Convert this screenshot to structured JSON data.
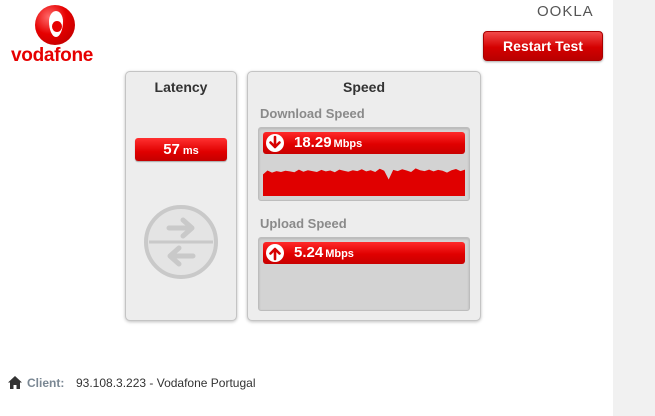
{
  "brand": {
    "name": "vodafone",
    "partner": "OOKLA"
  },
  "actions": {
    "restart_label": "Restart Test"
  },
  "latency": {
    "title": "Latency",
    "value": "57",
    "unit": "ms"
  },
  "speed": {
    "title": "Speed",
    "download": {
      "label": "Download Speed",
      "value": "18.29",
      "unit": "Mbps",
      "graph_samples": [
        0.72,
        0.85,
        0.78,
        0.83,
        0.8,
        0.84,
        0.82,
        0.79,
        0.88,
        0.81,
        0.86,
        0.83,
        0.8,
        0.87,
        0.82,
        0.85,
        0.79,
        0.88,
        0.84,
        0.81,
        0.86,
        0.83,
        0.89,
        0.82,
        0.86,
        0.8,
        0.91,
        0.84,
        0.55,
        0.87,
        0.83,
        0.89,
        0.85,
        0.8,
        0.92,
        0.86,
        0.83,
        0.88,
        0.82,
        0.87,
        0.84,
        0.78,
        0.86,
        0.9,
        0.83,
        0.88
      ]
    },
    "upload": {
      "label": "Upload Speed",
      "value": "5.24",
      "unit": "Mbps"
    }
  },
  "client": {
    "label": "Client:",
    "value": "93.108.3.223 - Vodafone Portugal"
  },
  "colors": {
    "accent": "#e60000",
    "panel_bg": "#ededed",
    "meter_bg": "#d3d3d3"
  }
}
